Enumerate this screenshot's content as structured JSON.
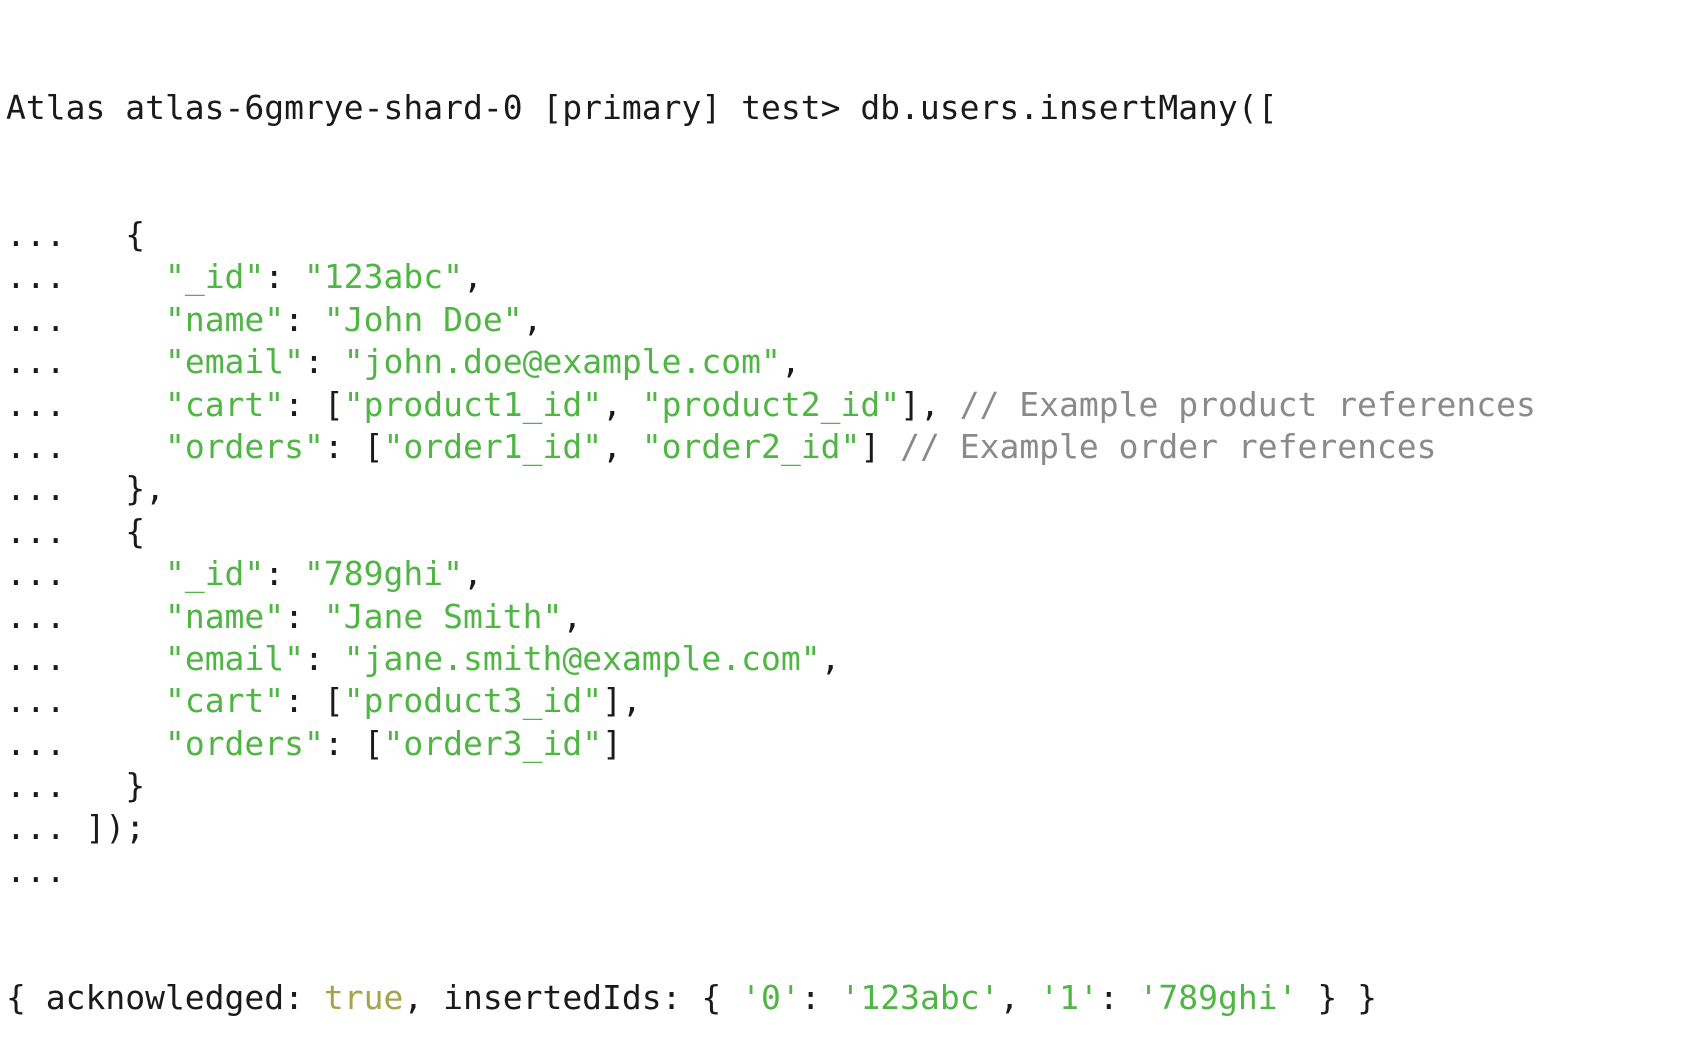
{
  "terminal": {
    "prompt": "Atlas atlas-6gmrye-shard-0 [primary] test> ",
    "command": "db.users.insertMany([",
    "cont": "...",
    "colors": {
      "text": "#1a1a1a",
      "string": "#4fb543",
      "comment": "#8a8a8a",
      "boolean": "#a7a34a",
      "background": "#ffffff"
    },
    "lines": [
      {
        "parts": [
          {
            "t": "...   {",
            "c": "k"
          }
        ]
      },
      {
        "parts": [
          {
            "t": "...     ",
            "c": "k"
          },
          {
            "t": "\"_id\"",
            "c": "g"
          },
          {
            "t": ": ",
            "c": "k"
          },
          {
            "t": "\"123abc\"",
            "c": "g"
          },
          {
            "t": ",",
            "c": "k"
          }
        ]
      },
      {
        "parts": [
          {
            "t": "...     ",
            "c": "k"
          },
          {
            "t": "\"name\"",
            "c": "g"
          },
          {
            "t": ": ",
            "c": "k"
          },
          {
            "t": "\"John Doe\"",
            "c": "g"
          },
          {
            "t": ",",
            "c": "k"
          }
        ]
      },
      {
        "parts": [
          {
            "t": "...     ",
            "c": "k"
          },
          {
            "t": "\"email\"",
            "c": "g"
          },
          {
            "t": ": ",
            "c": "k"
          },
          {
            "t": "\"john.doe@example.com\"",
            "c": "g"
          },
          {
            "t": ",",
            "c": "k"
          }
        ]
      },
      {
        "parts": [
          {
            "t": "...     ",
            "c": "k"
          },
          {
            "t": "\"cart\"",
            "c": "g"
          },
          {
            "t": ": [",
            "c": "k"
          },
          {
            "t": "\"product1_id\"",
            "c": "g"
          },
          {
            "t": ", ",
            "c": "k"
          },
          {
            "t": "\"product2_id\"",
            "c": "g"
          },
          {
            "t": "], ",
            "c": "k"
          },
          {
            "t": "// Example product references",
            "c": "c"
          }
        ]
      },
      {
        "parts": [
          {
            "t": "...     ",
            "c": "k"
          },
          {
            "t": "\"orders\"",
            "c": "g"
          },
          {
            "t": ": [",
            "c": "k"
          },
          {
            "t": "\"order1_id\"",
            "c": "g"
          },
          {
            "t": ", ",
            "c": "k"
          },
          {
            "t": "\"order2_id\"",
            "c": "g"
          },
          {
            "t": "] ",
            "c": "k"
          },
          {
            "t": "// Example order references",
            "c": "c"
          }
        ]
      },
      {
        "parts": [
          {
            "t": "...   },",
            "c": "k"
          }
        ]
      },
      {
        "parts": [
          {
            "t": "...   {",
            "c": "k"
          }
        ]
      },
      {
        "parts": [
          {
            "t": "...     ",
            "c": "k"
          },
          {
            "t": "\"_id\"",
            "c": "g"
          },
          {
            "t": ": ",
            "c": "k"
          },
          {
            "t": "\"789ghi\"",
            "c": "g"
          },
          {
            "t": ",",
            "c": "k"
          }
        ]
      },
      {
        "parts": [
          {
            "t": "...     ",
            "c": "k"
          },
          {
            "t": "\"name\"",
            "c": "g"
          },
          {
            "t": ": ",
            "c": "k"
          },
          {
            "t": "\"Jane Smith\"",
            "c": "g"
          },
          {
            "t": ",",
            "c": "k"
          }
        ]
      },
      {
        "parts": [
          {
            "t": "...     ",
            "c": "k"
          },
          {
            "t": "\"email\"",
            "c": "g"
          },
          {
            "t": ": ",
            "c": "k"
          },
          {
            "t": "\"jane.smith@example.com\"",
            "c": "g"
          },
          {
            "t": ",",
            "c": "k"
          }
        ]
      },
      {
        "parts": [
          {
            "t": "...     ",
            "c": "k"
          },
          {
            "t": "\"cart\"",
            "c": "g"
          },
          {
            "t": ": [",
            "c": "k"
          },
          {
            "t": "\"product3_id\"",
            "c": "g"
          },
          {
            "t": "],",
            "c": "k"
          }
        ]
      },
      {
        "parts": [
          {
            "t": "...     ",
            "c": "k"
          },
          {
            "t": "\"orders\"",
            "c": "g"
          },
          {
            "t": ": [",
            "c": "k"
          },
          {
            "t": "\"order3_id\"",
            "c": "g"
          },
          {
            "t": "]",
            "c": "k"
          }
        ]
      },
      {
        "parts": [
          {
            "t": "...   }",
            "c": "k"
          }
        ]
      },
      {
        "parts": [
          {
            "t": "... ]);",
            "c": "k"
          }
        ]
      },
      {
        "parts": [
          {
            "t": "...",
            "c": "k"
          }
        ]
      }
    ],
    "result": [
      {
        "t": "{ acknowledged: ",
        "c": "k"
      },
      {
        "t": "true",
        "c": "y"
      },
      {
        "t": ", insertedIds: { ",
        "c": "k"
      },
      {
        "t": "'0'",
        "c": "g"
      },
      {
        "t": ": ",
        "c": "k"
      },
      {
        "t": "'123abc'",
        "c": "g"
      },
      {
        "t": ", ",
        "c": "k"
      },
      {
        "t": "'1'",
        "c": "g"
      },
      {
        "t": ": ",
        "c": "k"
      },
      {
        "t": "'789ghi'",
        "c": "g"
      },
      {
        "t": " } }",
        "c": "k"
      }
    ]
  }
}
